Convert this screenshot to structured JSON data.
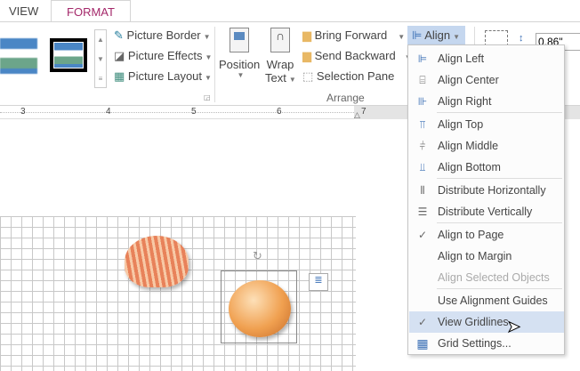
{
  "tabs": {
    "view": "VIEW",
    "format": "FORMAT"
  },
  "ribbon": {
    "picture_border": "Picture Border",
    "picture_effects": "Picture Effects",
    "picture_layout": "Picture Layout",
    "position": "Position",
    "wrap_text_1": "Wrap",
    "wrap_text_2": "Text",
    "bring_forward": "Bring Forward",
    "send_backward": "Send Backward",
    "selection_pane": "Selection Pane",
    "arrange_group": "Arrange",
    "align": "Align",
    "height_value": "0.86\""
  },
  "ruler": {
    "ticks": [
      "3",
      "4",
      "5",
      "6",
      "7"
    ]
  },
  "menu": {
    "items": [
      {
        "label": "Align Left",
        "icon": "align-left-icon"
      },
      {
        "label": "Align Center",
        "icon": "align-center-icon"
      },
      {
        "label": "Align Right",
        "icon": "align-right-icon"
      },
      {
        "label": "Align Top",
        "icon": "align-top-icon"
      },
      {
        "label": "Align Middle",
        "icon": "align-middle-icon"
      },
      {
        "label": "Align Bottom",
        "icon": "align-bottom-icon"
      },
      {
        "label": "Distribute Horizontally",
        "icon": "distribute-horizontal-icon"
      },
      {
        "label": "Distribute Vertically",
        "icon": "distribute-vertical-icon"
      },
      {
        "label": "Align to Page",
        "checked": true
      },
      {
        "label": "Align to Margin"
      },
      {
        "label": "Align Selected Objects",
        "disabled": true
      },
      {
        "label": "Use Alignment Guides"
      },
      {
        "label": "View Gridlines",
        "checked": true,
        "highlighted": true
      },
      {
        "label": "Grid Settings...",
        "icon": "grid-icon"
      }
    ]
  },
  "colors": {
    "accent": "#a4286a",
    "highlight": "#d5e1f2",
    "align_button": "#c5d7ef"
  }
}
